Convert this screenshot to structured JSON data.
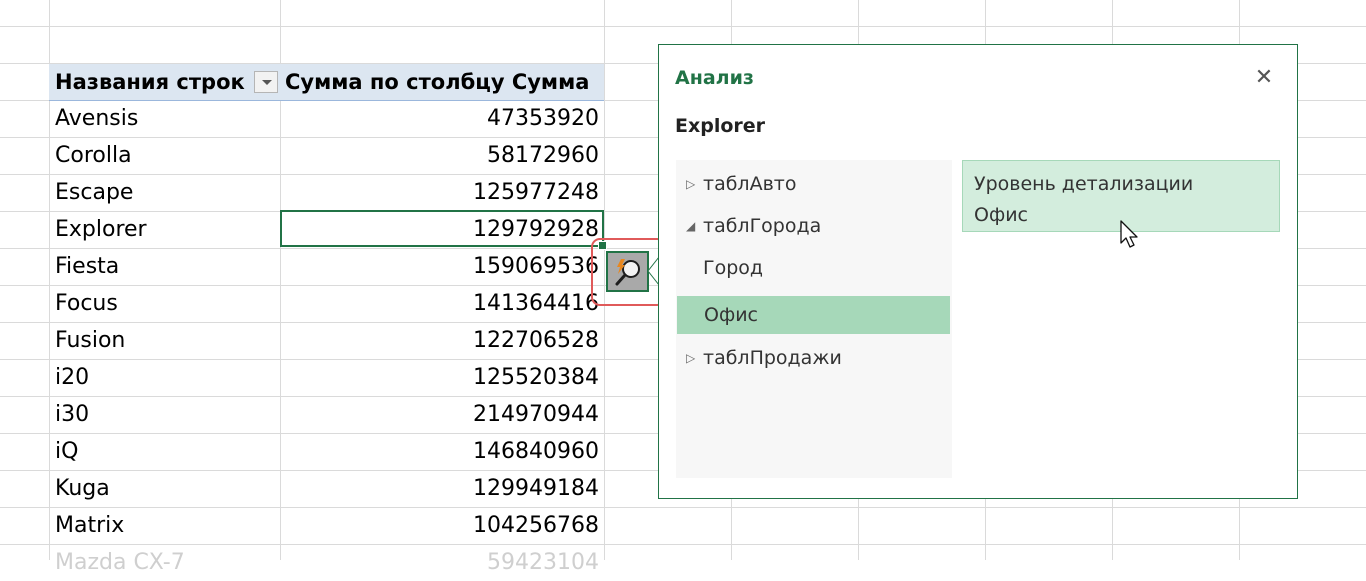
{
  "pivot": {
    "header_rows_label": "Названия строк",
    "header_sum_label": "Сумма по столбцу Сумма",
    "rows": [
      {
        "name": "Avensis",
        "value": "47353920"
      },
      {
        "name": "Corolla",
        "value": "58172960"
      },
      {
        "name": "Escape",
        "value": "125977248"
      },
      {
        "name": "Explorer",
        "value": "129792928"
      },
      {
        "name": "Fiesta",
        "value": "159069536"
      },
      {
        "name": "Focus",
        "value": "141364416"
      },
      {
        "name": "Fusion",
        "value": "122706528"
      },
      {
        "name": "i20",
        "value": "125520384"
      },
      {
        "name": "i30",
        "value": "214970944"
      },
      {
        "name": "iQ",
        "value": "146840960"
      },
      {
        "name": "Kuga",
        "value": "129949184"
      },
      {
        "name": "Matrix",
        "value": "104256768"
      },
      {
        "name": "Mazda CX-7",
        "value": "59423104"
      }
    ]
  },
  "explore": {
    "title": "Анализ",
    "subtitle": "Explorer",
    "tree": [
      {
        "label": "таблАвто",
        "arrow": "▷"
      },
      {
        "label": "таблГорода",
        "arrow": "◢"
      },
      {
        "label": "Город",
        "arrow": ""
      },
      {
        "label": "Офис",
        "arrow": ""
      },
      {
        "label": "таблПродажи",
        "arrow": "▷"
      }
    ],
    "drill_line1": "Уровень детализации",
    "drill_line2": "Офис",
    "close_glyph": "✕"
  },
  "colors": {
    "accent": "#217346",
    "selected_tree_item": "#a6d8b9",
    "drill_box": "#d3eddd",
    "pivot_header": "#dce6f1",
    "highlight_outline": "#e05a5a"
  }
}
